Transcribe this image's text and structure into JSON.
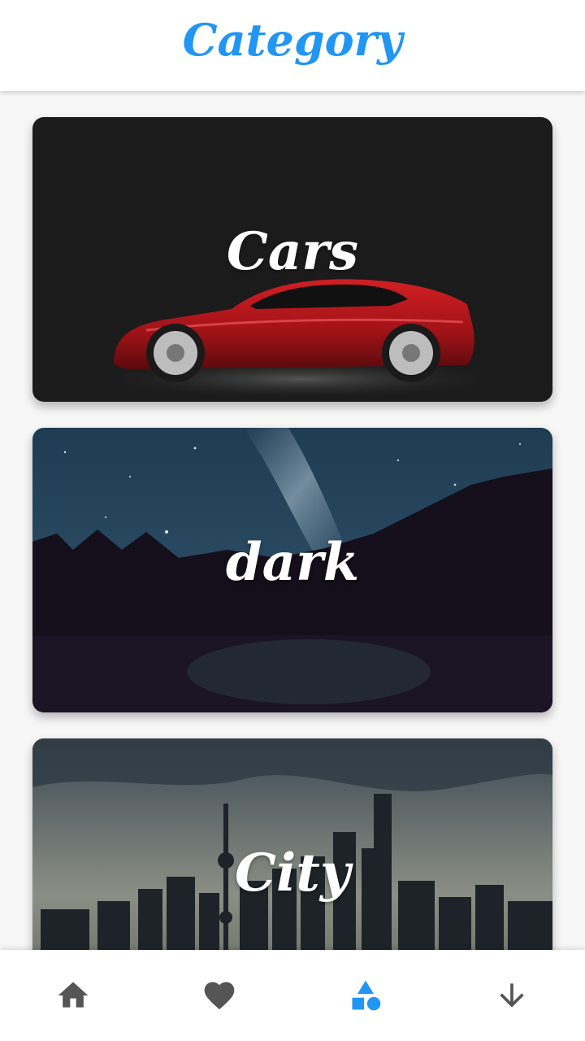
{
  "header": {
    "title": "Category",
    "title_color": "#2196F3"
  },
  "categories": [
    {
      "label": "Cars",
      "image": "red sports car on dark background"
    },
    {
      "label": "dark",
      "image": "night sky over forest lake"
    },
    {
      "label": "City",
      "image": "city skyline at dusk"
    }
  ],
  "bottom_nav": {
    "items": [
      {
        "icon": "home-icon",
        "active": false
      },
      {
        "icon": "heart-icon",
        "active": false
      },
      {
        "icon": "category-shapes-icon",
        "active": true
      },
      {
        "icon": "arrow-down-icon",
        "active": false
      }
    ],
    "active_color": "#2196F3",
    "inactive_color": "#555555"
  }
}
